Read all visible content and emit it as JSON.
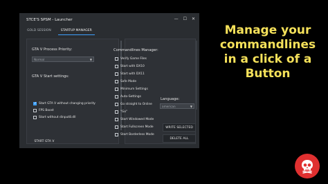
{
  "window": {
    "title": "STCE'S SPSM - Launcher",
    "controls": {
      "minimize": "—",
      "maximize": "☐",
      "close": "✕"
    }
  },
  "tabs": [
    {
      "label": "GOLD SESSION",
      "active": false
    },
    {
      "label": "STARTUP MANAGER",
      "active": true
    }
  ],
  "left": {
    "priority_label": "GTA V Process Priority:",
    "priority_value": "Normal",
    "start_settings_label": "GTA V Start settings:",
    "options": [
      {
        "label": "Start GTA V without changing priority",
        "checked": true
      },
      {
        "label": "FPS Boost",
        "checked": false
      },
      {
        "label": "Start without dinput8.dll",
        "checked": false
      }
    ],
    "start_button": "START GTA V"
  },
  "right": {
    "manager_label": "Commandlines Manager:",
    "commands": [
      {
        "label": "Verify Game Files",
        "checked": false
      },
      {
        "label": "Start with DX10",
        "checked": false
      },
      {
        "label": "Start with DX11",
        "checked": false
      },
      {
        "label": "Safe Mode",
        "checked": false
      },
      {
        "label": "Minimum Settings",
        "checked": false
      },
      {
        "label": "Auto-Settings",
        "checked": false
      },
      {
        "label": "Go straight to Online",
        "checked": false
      },
      {
        "label": "\"Go\"",
        "checked": false
      },
      {
        "label": "Start Windowed Mode",
        "checked": false
      },
      {
        "label": "Start Fullscreen Mode",
        "checked": false
      },
      {
        "label": "Start Borderless Mode",
        "checked": false
      }
    ],
    "language_label": "Language:",
    "language_value": "american",
    "write_button": "WRITE SELECTED",
    "delete_button": "DELETE ALL"
  },
  "promo": {
    "line1": "Manage your",
    "line2": "commandlines",
    "line3": "in a click of a",
    "line4": "Button"
  },
  "colors": {
    "promo_text": "#f5e15a",
    "badge": "#e03030",
    "accent": "#3ea0ff"
  },
  "icons": {
    "badge_icon": "skull-icon"
  }
}
